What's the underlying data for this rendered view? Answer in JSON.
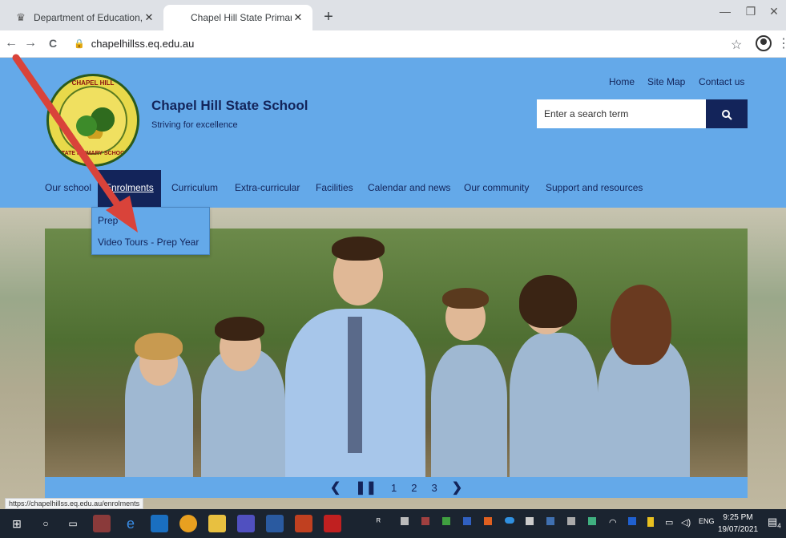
{
  "browser": {
    "tabs": [
      {
        "title": "Department of Education, Trainin",
        "close": "✕"
      },
      {
        "title": "Chapel Hill State Primary School",
        "close": "✕"
      }
    ],
    "new_tab": "+",
    "minimize": "—",
    "maximize": "❐",
    "close_window": "✕",
    "back": "←",
    "forward": "→",
    "reload": "C",
    "url": "chapelhillss.eq.edu.au",
    "lock_icon": "🔒",
    "star": "☆",
    "kebab": "⋮",
    "status_url": "https://chapelhillss.eq.edu.au/enrolments"
  },
  "site": {
    "logo": {
      "top_text": "CHAPEL HILL",
      "bottom_text": "STATE PRIMARY SCHOOL"
    },
    "name": "Chapel Hill State School",
    "tagline": "Striving for excellence",
    "top_links": [
      "Home",
      "Site Map",
      "Contact us"
    ],
    "search": {
      "placeholder": "Enter a search term",
      "icon": "search-icon"
    },
    "nav": [
      {
        "label": "Our school",
        "active": false
      },
      {
        "label": "Enrolments",
        "active": true
      },
      {
        "label": "Curriculum",
        "active": false
      },
      {
        "label": "Extra-curricular",
        "active": false
      },
      {
        "label": "Facilities",
        "active": false
      },
      {
        "label": "Calendar and news",
        "active": false
      },
      {
        "label": "Our community",
        "active": false
      },
      {
        "label": "Support and resources",
        "active": false
      }
    ],
    "dropdown": [
      "Prep",
      "Video Tours - Prep Year"
    ],
    "carousel": {
      "prev": "❮",
      "pause": "❚❚",
      "pages": [
        "1",
        "2",
        "3"
      ],
      "next": "❯"
    },
    "colors": {
      "header": "#64a9e9",
      "navy": "#13245a"
    }
  },
  "taskbar": {
    "time": "9:25 PM",
    "date": "19/07/2021",
    "lang": "ENG",
    "notifications": "4"
  }
}
